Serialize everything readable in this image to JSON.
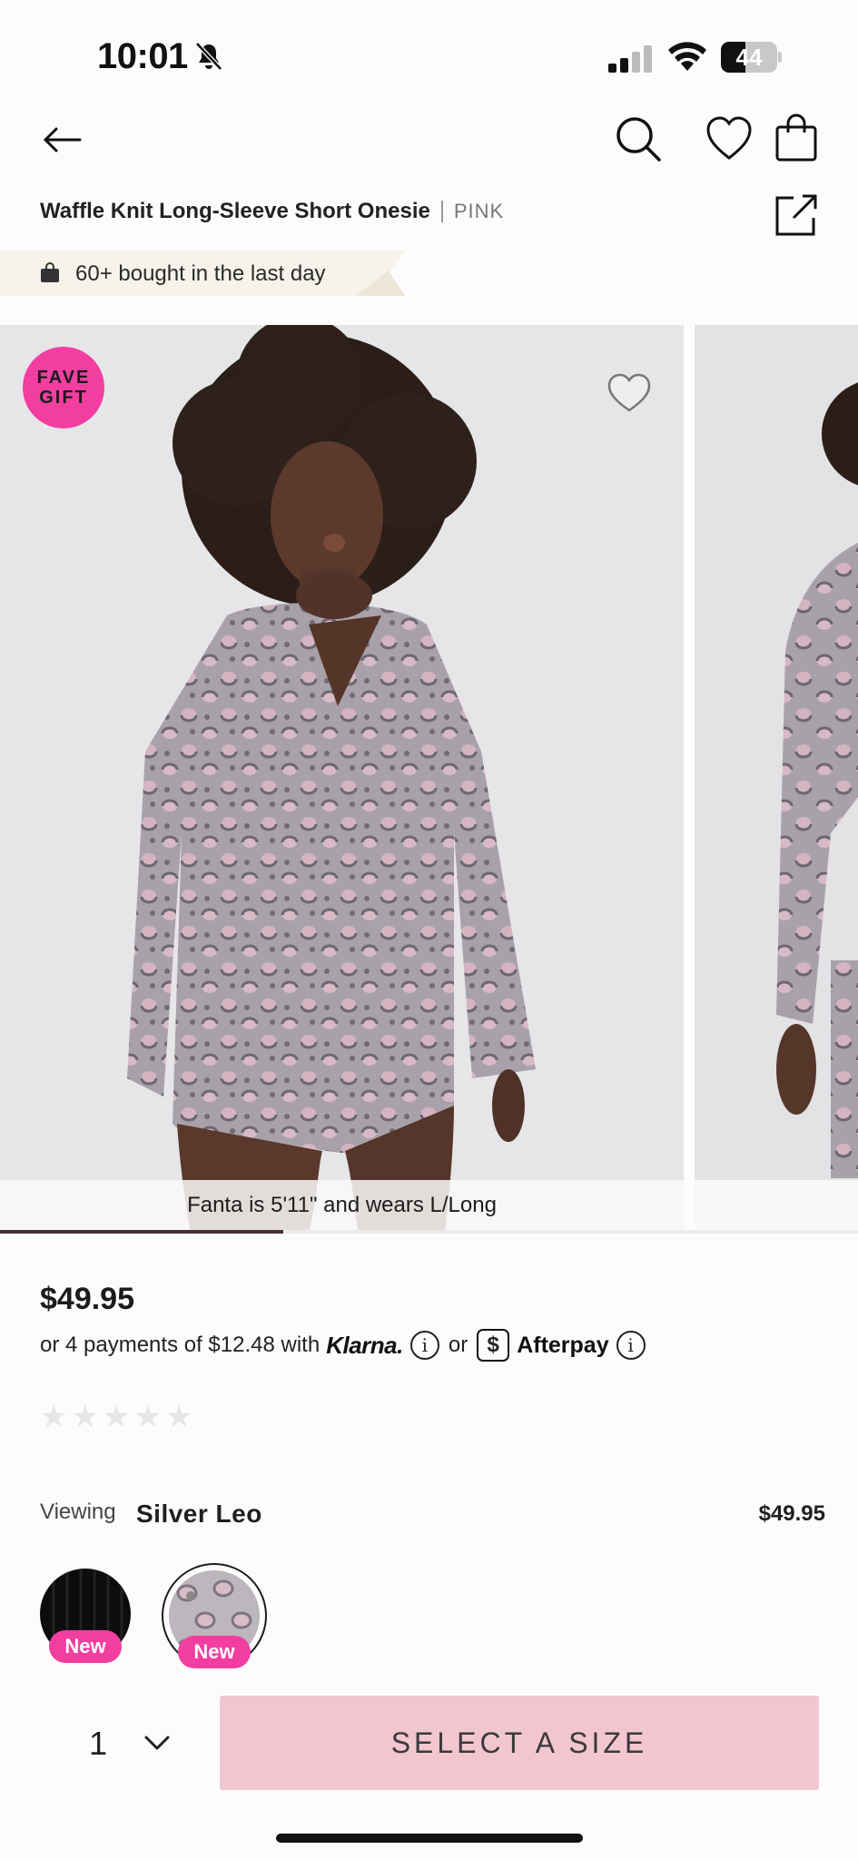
{
  "status_bar": {
    "time": "10:01",
    "battery": "44",
    "battery_level": 0.44
  },
  "product": {
    "title": "Waffle Knit Long-Sleeve Short Onesie",
    "brand": "PINK"
  },
  "bought_banner": {
    "text": "60+ bought in the last day"
  },
  "gallery": {
    "badge_line1": "FAVE",
    "badge_line2": "GIFT",
    "caption": "Fanta is 5'11\" and wears L/Long",
    "progress": 0.33
  },
  "price": {
    "amount": "$49.95",
    "payments_prefix": "or 4 payments of $12.48 with",
    "klarna": "Klarna.",
    "info": "i",
    "or": "or",
    "afterpay_symbol": "$",
    "afterpay": "Afterpay"
  },
  "rating": {
    "stars": 0,
    "max": 5,
    "star_glyph": "★"
  },
  "variant": {
    "viewing_label": "Viewing",
    "color_name": "Silver Leo",
    "price": "$49.95",
    "swatches": [
      {
        "color": "Black",
        "badge": "New"
      },
      {
        "color": "Silver Leo",
        "badge": "New"
      }
    ]
  },
  "actions": {
    "quantity": "1",
    "cta": "SELECT A SIZE"
  },
  "colors": {
    "accent_pink": "#f23ea1",
    "cta_bg": "#f2c6d1"
  }
}
